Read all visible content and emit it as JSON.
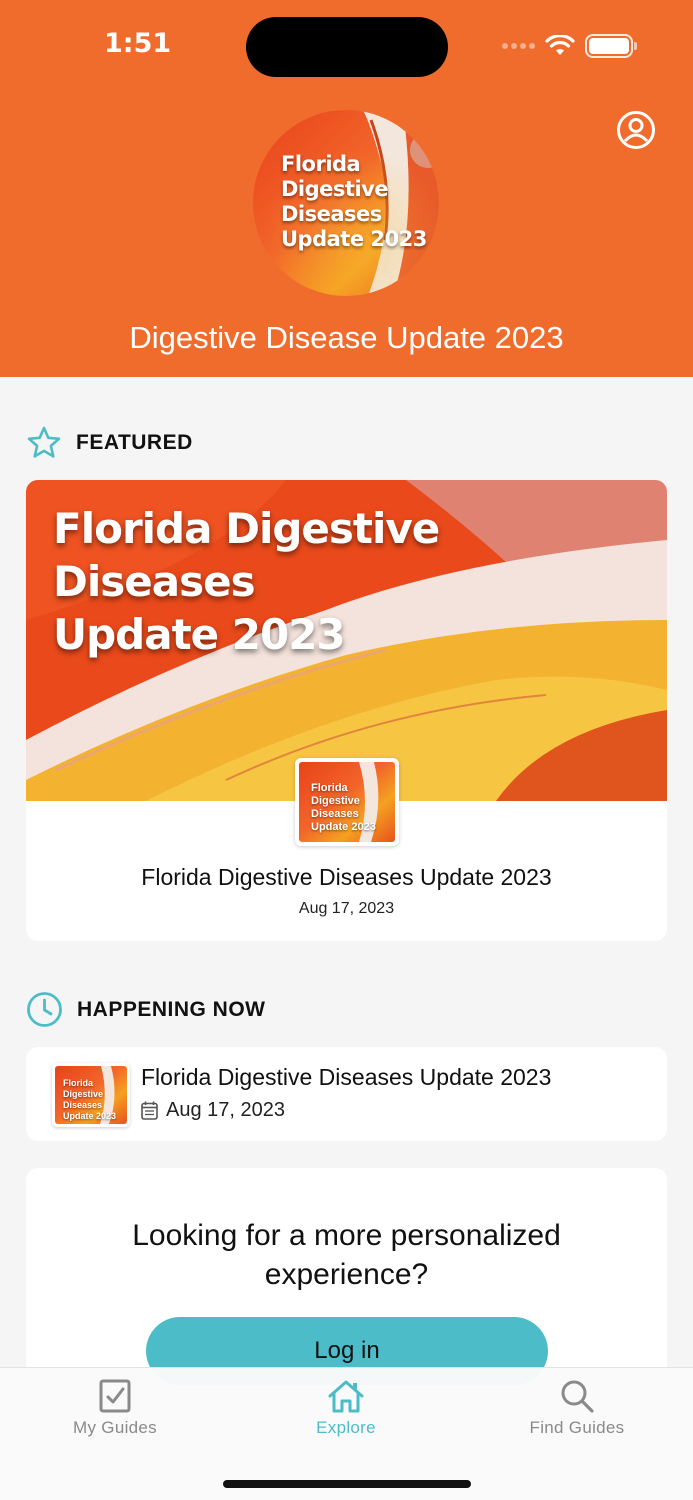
{
  "status_bar": {
    "time": "1:51"
  },
  "header": {
    "logo_text": [
      "Florida",
      "Digestive",
      "Diseases",
      "Update 2023"
    ],
    "title": "Digestive Disease Update 2023"
  },
  "featured": {
    "section_label": "FEATURED",
    "banner_text": [
      "Florida Digestive",
      "Diseases",
      "Update 2023"
    ],
    "thumb_text": [
      "Florida",
      "Digestive",
      "Diseases",
      "Update 2023"
    ],
    "name": "Florida Digestive Diseases Update 2023",
    "date": "Aug 17, 2023"
  },
  "happening_now": {
    "section_label": "HAPPENING NOW",
    "thumb_text": [
      "Florida",
      "Digestive",
      "Diseases",
      "Update 2023"
    ],
    "name": "Florida Digestive Diseases Update 2023",
    "date": "Aug 17, 2023"
  },
  "login_prompt": {
    "text": "Looking for a more personalized experience?",
    "button_label": "Log in"
  },
  "tabs": [
    {
      "label": "My Guides",
      "icon": "checklist-icon",
      "active": false
    },
    {
      "label": "Explore",
      "icon": "home-icon",
      "active": true
    },
    {
      "label": "Find Guides",
      "icon": "search-icon",
      "active": false
    }
  ],
  "colors": {
    "brand_orange": "#f06c2c",
    "accent_teal": "#4dbcc9",
    "background": "#f5f5f5"
  }
}
